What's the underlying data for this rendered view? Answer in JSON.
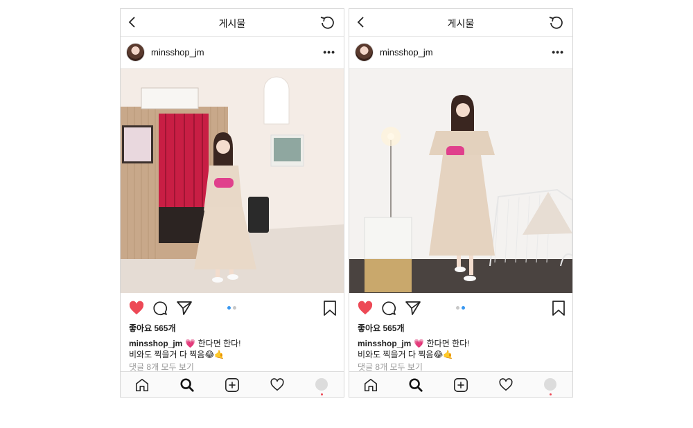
{
  "posts": [
    {
      "screen_title": "게시물",
      "username": "minsshop_jm",
      "likes": "좋아요 565개",
      "caption_user": "minsshop_jm",
      "caption_text": "💗 한다면 한다!",
      "caption_line2": "비와도 찍을거 다 찍음😂🤙",
      "comments_link": "댓글 8개 모두 보기",
      "carousel_active_index": 0,
      "liked": true
    },
    {
      "screen_title": "게시물",
      "username": "minsshop_jm",
      "likes": "좋아요 565개",
      "caption_user": "minsshop_jm",
      "caption_text": "💗 한다면 한다!",
      "caption_line2": "비와도 찍을거 다 찍음😂🤙",
      "comments_link": "댓글 8개 모두 보기",
      "carousel_active_index": 1,
      "liked": true
    }
  ],
  "icons": {
    "back": "chevron-left-icon",
    "refresh": "refresh-icon",
    "more": "more-icon",
    "like": "heart-icon",
    "comment": "comment-icon",
    "share": "send-icon",
    "save": "bookmark-icon",
    "home": "home-icon",
    "search": "search-icon",
    "add": "add-post-icon",
    "activity": "heart-outline-icon",
    "profile": "profile-avatar"
  },
  "colors": {
    "like_red": "#ed4956",
    "carousel_active": "#3897f0",
    "carousel_inactive": "#c7c7c7",
    "comments_gray": "#999999"
  },
  "more_glyph": "•••"
}
